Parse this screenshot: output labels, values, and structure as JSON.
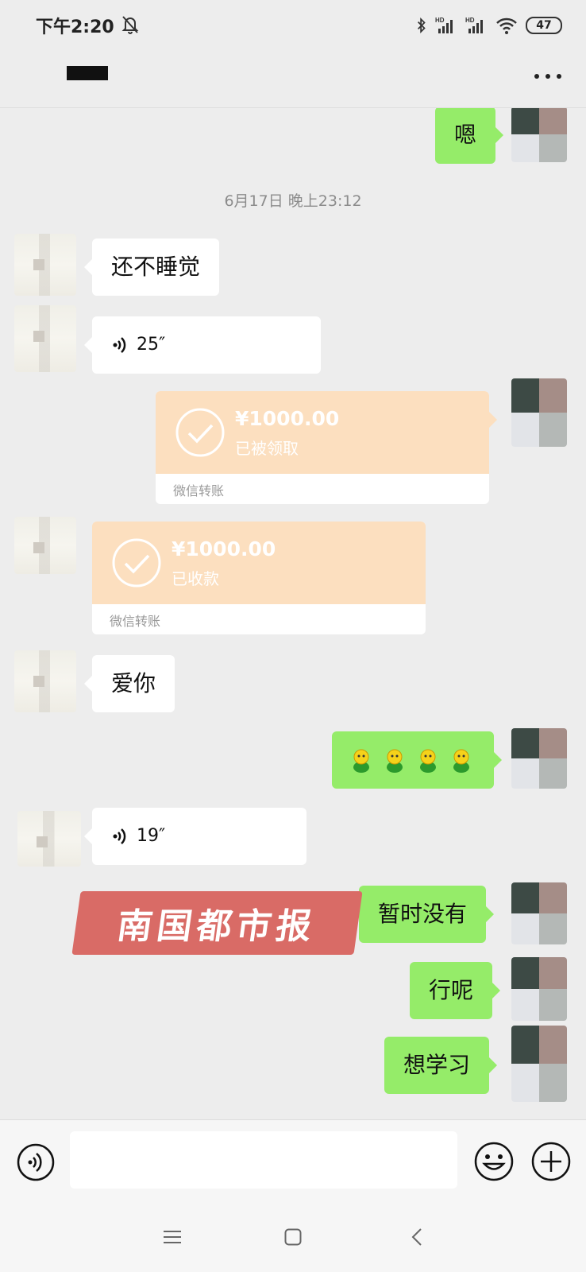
{
  "status_bar": {
    "time": "下午2:20",
    "battery": "47",
    "icons": [
      "bell-off-icon",
      "bluetooth-icon",
      "hd-signal-icon",
      "hd-signal-icon",
      "wifi-icon",
      "battery-icon"
    ]
  },
  "header": {
    "title_redacted": true,
    "more_icon": "more-icon"
  },
  "chat": {
    "timestamp": "6月17日 晚上23:12",
    "messages": [
      {
        "side": "out",
        "type": "text",
        "text": "嗯"
      },
      {
        "side": "in",
        "type": "text",
        "text": "还不睡觉"
      },
      {
        "side": "in",
        "type": "voice",
        "duration": "25″"
      },
      {
        "side": "out",
        "type": "transfer",
        "amount": "¥1000.00",
        "status": "已被领取",
        "label": "微信转账"
      },
      {
        "side": "in",
        "type": "transfer",
        "amount": "¥1000.00",
        "status": "已收款",
        "label": "微信转账"
      },
      {
        "side": "in",
        "type": "text",
        "text": "爱你"
      },
      {
        "side": "out",
        "type": "emoji",
        "emoji_count": 4
      },
      {
        "side": "in",
        "type": "voice",
        "duration": "19″"
      },
      {
        "side": "out",
        "type": "text",
        "text": "暂时没有"
      },
      {
        "side": "out",
        "type": "text",
        "text": "行呢"
      },
      {
        "side": "out",
        "type": "text",
        "text": "想学习"
      }
    ]
  },
  "watermark": {
    "text": "南国都市报"
  },
  "input_bar": {
    "placeholder": "",
    "icons": [
      "voice-input-icon",
      "emoji-icon",
      "plus-icon"
    ]
  },
  "nav_bar": {
    "icons": [
      "menu-icon",
      "home-icon",
      "back-icon"
    ]
  },
  "colors": {
    "background": "#ededed",
    "outgoing_bubble": "#95ec69",
    "incoming_bubble": "#ffffff",
    "transfer_bubble": "#fcdfbf",
    "watermark": "#d96b66"
  }
}
